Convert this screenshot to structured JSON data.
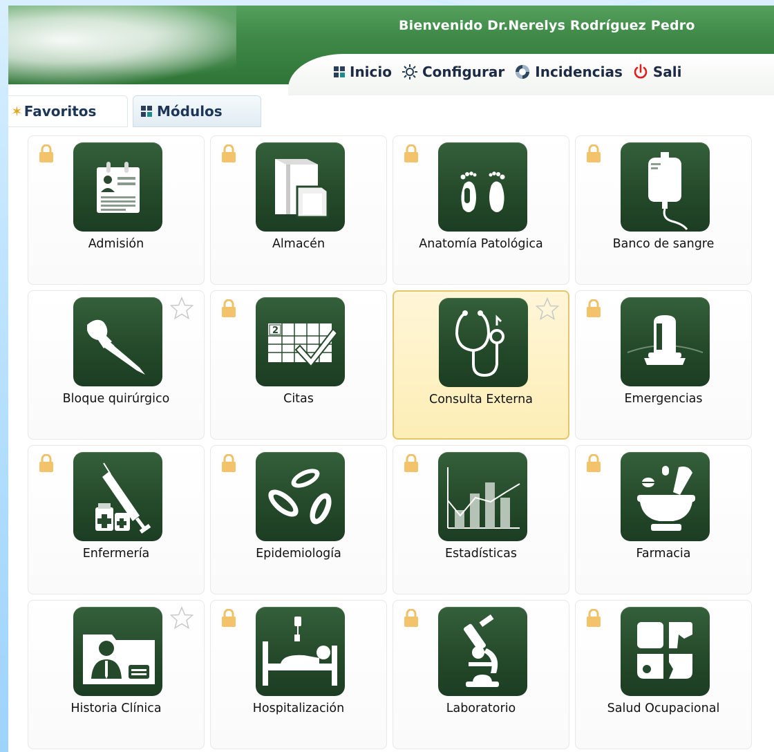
{
  "header": {
    "welcome": "Bienvenido Dr.Nerelys Rodríguez Pedro",
    "nav": [
      {
        "label": "Inicio",
        "icon": "grid-icon"
      },
      {
        "label": "Configurar",
        "icon": "gear-icon"
      },
      {
        "label": "Incidencias",
        "icon": "lifebuoy-icon"
      },
      {
        "label": "Sali",
        "icon": "power-icon"
      }
    ]
  },
  "tabs": [
    {
      "label": "Favoritos",
      "icon": "star-icon",
      "active": false
    },
    {
      "label": "Módulos",
      "icon": "grid-icon",
      "active": true
    }
  ],
  "modules": [
    {
      "label": "Admisión",
      "icon": "admission-clipboard-icon",
      "locked": true,
      "favorite_star": false,
      "highlighted": false
    },
    {
      "label": "Almacén",
      "icon": "warehouse-boxes-icon",
      "locked": true,
      "favorite_star": false,
      "highlighted": false
    },
    {
      "label": "Anatomía Patológica",
      "icon": "feet-icon",
      "locked": true,
      "favorite_star": false,
      "highlighted": false
    },
    {
      "label": "Banco de sangre",
      "icon": "blood-bag-icon",
      "locked": true,
      "favorite_star": false,
      "highlighted": false
    },
    {
      "label": "Bloque quirúrgico",
      "icon": "scalpel-icon",
      "locked": false,
      "favorite_star": true,
      "highlighted": false
    },
    {
      "label": "Citas",
      "icon": "calendar-check-icon",
      "locked": true,
      "favorite_star": false,
      "highlighted": false
    },
    {
      "label": "Consulta Externa",
      "icon": "stethoscope-icon",
      "locked": false,
      "favorite_star": true,
      "highlighted": true
    },
    {
      "label": "Emergencias",
      "icon": "siren-light-icon",
      "locked": true,
      "favorite_star": false,
      "highlighted": false
    },
    {
      "label": "Enfermería",
      "icon": "syringe-vials-icon",
      "locked": true,
      "favorite_star": false,
      "highlighted": false
    },
    {
      "label": "Epidemiología",
      "icon": "bacteria-icon",
      "locked": true,
      "favorite_star": false,
      "highlighted": false
    },
    {
      "label": "Estadísticas",
      "icon": "bar-chart-icon",
      "locked": true,
      "favorite_star": false,
      "highlighted": false
    },
    {
      "label": "Farmacia",
      "icon": "mortar-pestle-icon",
      "locked": true,
      "favorite_star": false,
      "highlighted": false
    },
    {
      "label": "Historia Clínica",
      "icon": "patient-folder-icon",
      "locked": false,
      "favorite_star": true,
      "highlighted": false
    },
    {
      "label": "Hospitalización",
      "icon": "hospital-bed-icon",
      "locked": true,
      "favorite_star": false,
      "highlighted": false
    },
    {
      "label": "Laboratorio",
      "icon": "microscope-icon",
      "locked": true,
      "favorite_star": false,
      "highlighted": false
    },
    {
      "label": "Salud Ocupacional",
      "icon": "occupational-health-icon",
      "locked": true,
      "favorite_star": false,
      "highlighted": false
    }
  ],
  "colors": {
    "header_green": "#3f8948",
    "tile_icon_green": "#254a2b",
    "highlight_bg": "#fdeeb5",
    "lock_gold": "#f2c36b",
    "power_red": "#e11d1d"
  }
}
